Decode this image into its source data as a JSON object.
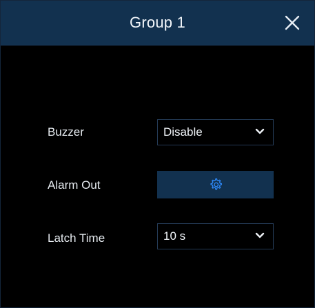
{
  "dialog": {
    "title": "Group 1",
    "close_icon": "close-icon"
  },
  "fields": {
    "buzzer": {
      "label": "Buzzer",
      "value": "Disable"
    },
    "alarm_out": {
      "label": "Alarm Out",
      "icon": "gear-icon"
    },
    "latch_time": {
      "label": "Latch Time",
      "value": "10 s"
    }
  },
  "colors": {
    "titlebar": "#12314f",
    "background": "#000000",
    "accent": "#2f8cff",
    "field_border": "#243a55"
  }
}
